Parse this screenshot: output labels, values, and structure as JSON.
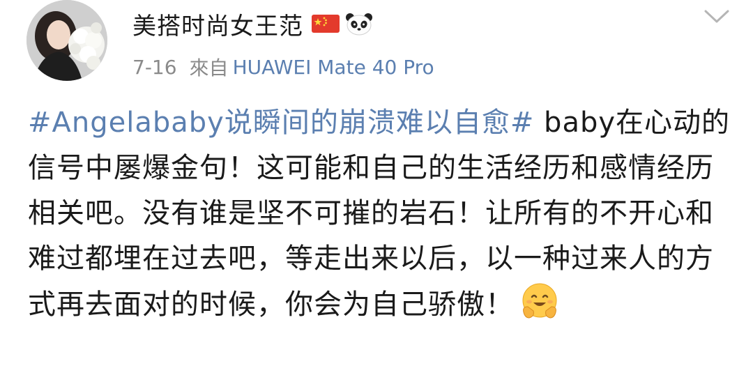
{
  "post": {
    "username": "美搭时尚女王范",
    "date": "7-16",
    "source_prefix": "來自",
    "device": "HUAWEI Mate 40 Pro",
    "hashtag": "#Angelababy说瞬间的崩溃难以自愈#",
    "body_text": " baby在心动的信号中屡爆金句！这可能和自己的生活经历和感情经历相关吧。没有谁是坚不可摧的岩石！让所有的不开心和难过都埋在过去吧，等走出来以后，以一种过来人的方式再去面对的时候，你会为自己骄傲！",
    "badges": [
      "china-flag-icon",
      "panda-icon"
    ],
    "trailing_emoji": "hugging-face-icon",
    "colors": {
      "link": "#5b7fb0",
      "meta": "#8a8a8a",
      "text": "#1a1a1a"
    }
  }
}
